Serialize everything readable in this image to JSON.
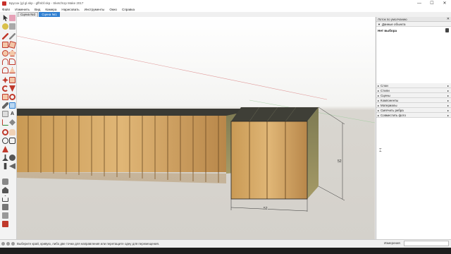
{
  "window": {
    "title": "Брусок (gl gl.skp - gffmbf.skp - SketchUp Make 2017",
    "minimize": "—",
    "maximize": "☐",
    "close": "✕"
  },
  "menu": [
    "Файл",
    "Изменить",
    "Вид",
    "Камера",
    "Нарисовать",
    "Инструменты",
    "Окно",
    "Справка"
  ],
  "scene_tabs": [
    {
      "label": "Сцена №2",
      "active": false
    },
    {
      "label": "Сцена №1",
      "active": true
    }
  ],
  "right_panel": {
    "header": "Лоток по умолчанию",
    "close": "✕",
    "entity_section": "Данные объекта",
    "entity_value": "Нет выбора",
    "sections": [
      "Слои",
      "Стили",
      "Сцены",
      "Компоненты",
      "Материалы",
      "Смягчить ребра",
      "Совместить фото"
    ]
  },
  "dimensions": {
    "vertical": "52",
    "horizontal": "52"
  },
  "status": {
    "message": "Выберите край, кривую, либо две точки для направления или перетащите одну для перемещения.",
    "measurements_label": "Измерения",
    "measurements_value": ""
  },
  "colors": {
    "accent": "#2f7fd1",
    "wood_light": "#d9b27a",
    "wood_dark": "#8a5f2a",
    "wood_top": "#4a4a40"
  },
  "icons": [
    "select-icon",
    "eraser-icon",
    "paint-icon",
    "pencil-icon",
    "rectangle-icon",
    "circle-icon",
    "arc-icon",
    "push-pull-icon",
    "move-icon",
    "rotate-icon",
    "scale-icon",
    "offset-icon",
    "tape-measure-icon",
    "text-icon",
    "axes-icon",
    "orbit-icon",
    "pan-icon",
    "zoom-icon",
    "walk-icon",
    "position-camera-icon",
    "warehouse-icon",
    "extension-icon"
  ]
}
